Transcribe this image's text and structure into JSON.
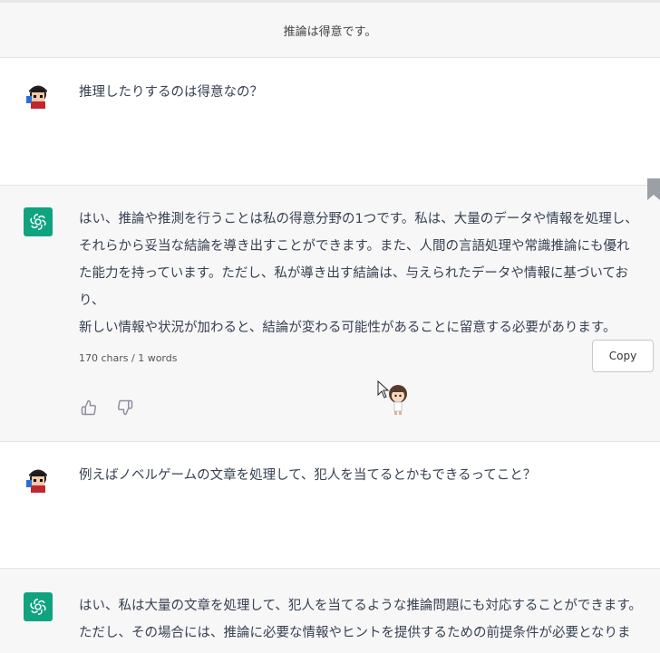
{
  "header": {
    "title": "推論は得意です。"
  },
  "messages": [
    {
      "role": "user",
      "text": "推理したりするのは得意なの？"
    },
    {
      "role": "assistant",
      "text": "はい、推論や推測を行うことは私の得意分野の1つです。私は、大量のデータや情報を処理し、\nそれらから妥当な結論を導き出すことができます。また、人間の言語処理や常識推論にも優れ\nた能力を持っています。ただし、私が導き出す結論は、与えられたデータや情報に基づいており、\n新しい情報や状況が加わると、結論が変わる可能性があることに留意する必要があります。"
    },
    {
      "role": "user",
      "text": "例えばノベルゲームの文章を処理して、犯人を当てるとかもできるってこと？"
    },
    {
      "role": "assistant",
      "text": "はい、私は大量の文章を処理して、犯人を当てるような推論問題にも対応することができます。\nただし、その場合には、推論に必要な情報やヒントを提供するための前提条件が必要となりま"
    }
  ],
  "toolbar": {
    "char_count": "170 chars / 1 words",
    "copy_label": "Copy"
  },
  "icons": {
    "gpt_logo": "openai-logo-icon",
    "thumbs_up": "thumbs-up-icon",
    "thumbs_down": "thumbs-down-icon",
    "bookmark": "bookmark-icon"
  },
  "colors": {
    "gpt_logo_bg": "#10a37f",
    "assistant_bg": "#f7f7f8",
    "user_bg": "#ffffff"
  }
}
